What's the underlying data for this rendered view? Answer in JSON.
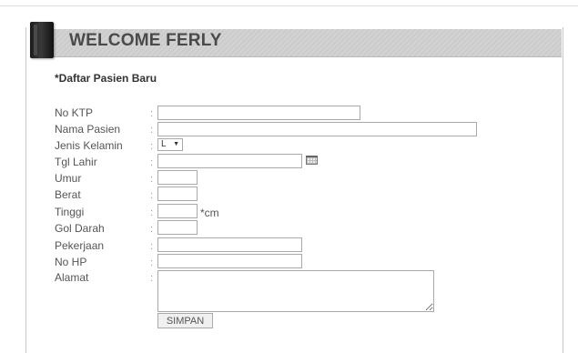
{
  "header": {
    "title": "WELCOME FERLY"
  },
  "form": {
    "section_title": "*Daftar Pasien Baru",
    "fields": {
      "no_ktp": {
        "label": "No KTP",
        "value": ""
      },
      "nama_pasien": {
        "label": "Nama Pasien",
        "value": ""
      },
      "jenis_kelamin": {
        "label": "Jenis Kelamin",
        "selected": "L"
      },
      "tgl_lahir": {
        "label": "Tgl Lahir",
        "value": ""
      },
      "umur": {
        "label": "Umur",
        "value": ""
      },
      "berat": {
        "label": "Berat",
        "value": ""
      },
      "tinggi": {
        "label": "Tinggi",
        "value": "",
        "unit": "*cm"
      },
      "gol_darah": {
        "label": "Gol Darah",
        "value": ""
      },
      "pekerjaan": {
        "label": "Pekerjaan",
        "value": ""
      },
      "no_hp": {
        "label": "No HP",
        "value": ""
      },
      "alamat": {
        "label": "Alamat",
        "value": ""
      }
    },
    "separator": ":",
    "submit_label": "SIMPAN"
  },
  "icons": {
    "calendar": "calendar-icon",
    "dropdown": "chevron-down-icon",
    "resize": "resize-grip-icon"
  },
  "colors": {
    "header_bg": "#d0d0d0",
    "header_text": "#4a4a4a",
    "block": "#1a1a1a",
    "border": "#aaaaaa"
  }
}
